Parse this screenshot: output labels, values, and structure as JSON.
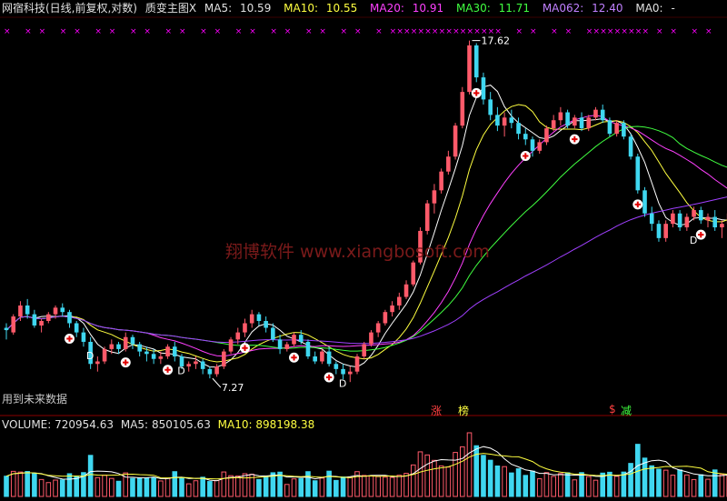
{
  "header": {
    "name": "网宿科技(日线,前复权,对数)",
    "indicator": "质变主图X",
    "ma5_label": "MA5:",
    "ma5_val": "10.59",
    "ma10_label": "MA10:",
    "ma10_val": "10.55",
    "ma20_label": "MA20:",
    "ma20_val": "10.91",
    "ma30_label": "MA30:",
    "ma30_val": "11.71",
    "ma062_label": "MA062:",
    "ma062_val": "12.40",
    "ma0_label": "MA0:",
    "ma0_val": "-"
  },
  "watermark": "翔博软件 www.xiangbosoft.com",
  "note": "用到未来数据",
  "volume_header": {
    "vol_label": "VOLUME:",
    "vol_val": "720954.63",
    "ma5_label": "MA5:",
    "ma5_val": "850105.63",
    "ma10_label": "MA10:",
    "ma10_val": "898198.38"
  },
  "tags": {
    "zhang": "涨",
    "bang": "榜",
    "s": "$",
    "jian": "减"
  },
  "colors": {
    "up": "#ff5a6a",
    "down": "#3fd7f0",
    "ma5": "#ffffff",
    "ma10": "#ffff40",
    "ma20": "#ff40ff",
    "ma30": "#40ff40",
    "ma062": "#a040ff",
    "mark": "#ff00ff"
  },
  "chart_data": {
    "type": "candlestick",
    "high_label": "17.62",
    "low_label": "7.27",
    "ohlc": [
      [
        8.3,
        8.4,
        8.05,
        8.25
      ],
      [
        8.2,
        8.6,
        8.15,
        8.55
      ],
      [
        8.55,
        8.9,
        8.45,
        8.8
      ],
      [
        8.8,
        8.95,
        8.5,
        8.6
      ],
      [
        8.6,
        8.7,
        8.3,
        8.35
      ],
      [
        8.35,
        8.5,
        8.2,
        8.45
      ],
      [
        8.45,
        8.65,
        8.4,
        8.6
      ],
      [
        8.6,
        8.8,
        8.5,
        8.75
      ],
      [
        8.75,
        8.85,
        8.55,
        8.65
      ],
      [
        8.65,
        8.7,
        8.3,
        8.4
      ],
      [
        8.4,
        8.45,
        8.1,
        8.2
      ],
      [
        8.2,
        8.3,
        7.9,
        8.0
      ],
      [
        8.0,
        8.1,
        7.45,
        7.55
      ],
      [
        7.55,
        7.7,
        7.4,
        7.6
      ],
      [
        7.6,
        7.9,
        7.55,
        7.85
      ],
      [
        7.85,
        8.05,
        7.75,
        7.95
      ],
      [
        7.95,
        8.0,
        7.75,
        7.85
      ],
      [
        7.85,
        8.2,
        7.8,
        8.1
      ],
      [
        8.1,
        8.15,
        7.85,
        7.95
      ],
      [
        7.95,
        8.0,
        7.7,
        7.8
      ],
      [
        7.8,
        7.9,
        7.6,
        7.75
      ],
      [
        7.75,
        7.85,
        7.55,
        7.65
      ],
      [
        7.65,
        7.8,
        7.55,
        7.7
      ],
      [
        7.7,
        7.95,
        7.65,
        7.9
      ],
      [
        7.9,
        8.0,
        7.6,
        7.7
      ],
      [
        7.7,
        7.75,
        7.45,
        7.5
      ],
      [
        7.5,
        7.6,
        7.4,
        7.55
      ],
      [
        7.55,
        7.7,
        7.45,
        7.6
      ],
      [
        7.6,
        7.65,
        7.35,
        7.45
      ],
      [
        7.45,
        7.5,
        7.27,
        7.35
      ],
      [
        7.35,
        7.55,
        7.3,
        7.5
      ],
      [
        7.5,
        7.85,
        7.45,
        7.8
      ],
      [
        7.8,
        8.1,
        7.75,
        8.05
      ],
      [
        8.05,
        8.3,
        7.95,
        8.2
      ],
      [
        8.2,
        8.5,
        8.1,
        8.4
      ],
      [
        8.4,
        8.7,
        8.3,
        8.6
      ],
      [
        8.6,
        8.65,
        8.35,
        8.45
      ],
      [
        8.45,
        8.55,
        8.2,
        8.3
      ],
      [
        8.3,
        8.4,
        8.0,
        8.05
      ],
      [
        8.05,
        8.15,
        7.75,
        7.85
      ],
      [
        7.85,
        8.0,
        7.8,
        7.95
      ],
      [
        7.95,
        8.2,
        7.9,
        8.15
      ],
      [
        8.15,
        8.25,
        7.95,
        8.0
      ],
      [
        8.0,
        8.05,
        7.65,
        7.7
      ],
      [
        7.7,
        7.8,
        7.55,
        7.6
      ],
      [
        7.6,
        7.85,
        7.55,
        7.8
      ],
      [
        7.8,
        7.9,
        7.5,
        7.55
      ],
      [
        7.55,
        7.6,
        7.35,
        7.45
      ],
      [
        7.45,
        7.55,
        7.25,
        7.35
      ],
      [
        7.35,
        7.5,
        7.2,
        7.4
      ],
      [
        7.4,
        7.75,
        7.35,
        7.7
      ],
      [
        7.7,
        8.0,
        7.65,
        7.95
      ],
      [
        7.95,
        8.25,
        7.9,
        8.2
      ],
      [
        8.2,
        8.45,
        8.1,
        8.4
      ],
      [
        8.4,
        8.7,
        8.35,
        8.65
      ],
      [
        8.65,
        8.9,
        8.55,
        8.8
      ],
      [
        8.8,
        9.1,
        8.7,
        9.0
      ],
      [
        9.0,
        9.4,
        8.95,
        9.3
      ],
      [
        9.3,
        9.9,
        9.25,
        9.85
      ],
      [
        9.85,
        10.8,
        9.8,
        10.7
      ],
      [
        10.7,
        11.6,
        10.6,
        11.5
      ],
      [
        11.5,
        12.1,
        11.2,
        11.9
      ],
      [
        11.9,
        12.6,
        11.8,
        12.5
      ],
      [
        12.5,
        13.2,
        12.4,
        13.0
      ],
      [
        13.0,
        14.2,
        12.9,
        14.1
      ],
      [
        14.1,
        15.6,
        14.0,
        15.4
      ],
      [
        15.4,
        17.62,
        15.3,
        17.4
      ],
      [
        17.4,
        17.5,
        15.8,
        16.0
      ],
      [
        16.0,
        16.2,
        14.9,
        15.1
      ],
      [
        15.1,
        15.4,
        14.3,
        14.5
      ],
      [
        14.5,
        14.8,
        13.9,
        14.1
      ],
      [
        14.1,
        14.6,
        13.7,
        14.4
      ],
      [
        14.4,
        14.7,
        14.0,
        14.2
      ],
      [
        14.2,
        14.4,
        13.6,
        13.8
      ],
      [
        13.8,
        14.0,
        13.4,
        13.6
      ],
      [
        13.6,
        13.7,
        13.0,
        13.2
      ],
      [
        13.2,
        13.6,
        13.1,
        13.5
      ],
      [
        13.5,
        14.1,
        13.4,
        14.0
      ],
      [
        14.0,
        14.5,
        13.9,
        14.3
      ],
      [
        14.3,
        14.8,
        14.1,
        14.6
      ],
      [
        14.6,
        14.7,
        14.0,
        14.1
      ],
      [
        14.1,
        14.5,
        14.0,
        14.4
      ],
      [
        14.4,
        14.6,
        13.9,
        14.0
      ],
      [
        14.0,
        14.5,
        13.9,
        14.4
      ],
      [
        14.4,
        14.8,
        14.3,
        14.7
      ],
      [
        14.7,
        14.9,
        14.2,
        14.3
      ],
      [
        14.3,
        14.4,
        13.7,
        13.8
      ],
      [
        13.8,
        14.3,
        13.7,
        14.2
      ],
      [
        14.2,
        14.3,
        13.6,
        13.7
      ],
      [
        13.7,
        13.8,
        12.9,
        13.0
      ],
      [
        13.0,
        13.1,
        11.8,
        11.9
      ],
      [
        11.9,
        12.0,
        11.1,
        11.2
      ],
      [
        11.2,
        11.4,
        10.7,
        10.9
      ],
      [
        10.9,
        11.0,
        10.4,
        10.5
      ],
      [
        10.5,
        11.0,
        10.4,
        10.9
      ],
      [
        10.9,
        11.3,
        10.8,
        11.2
      ],
      [
        11.2,
        11.3,
        10.7,
        10.8
      ],
      [
        10.8,
        11.2,
        10.7,
        11.1
      ],
      [
        11.1,
        11.4,
        11.0,
        11.3
      ],
      [
        11.3,
        11.4,
        10.9,
        11.0
      ],
      [
        11.0,
        11.2,
        10.8,
        11.1
      ],
      [
        11.1,
        11.3,
        10.7,
        10.8
      ],
      [
        10.8,
        11.0,
        10.5,
        10.9
      ],
      [
        10.9,
        11.3,
        10.8,
        11.2
      ]
    ]
  }
}
